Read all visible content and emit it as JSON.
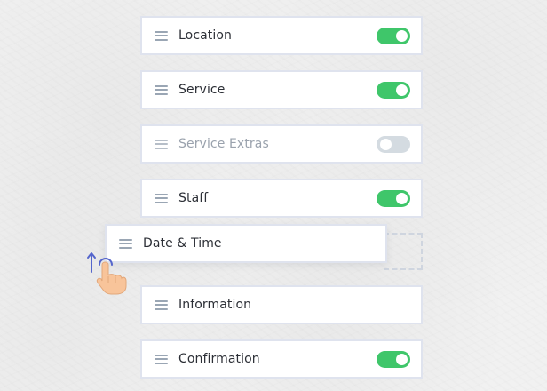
{
  "steps": [
    {
      "label": "Location",
      "toggle": "on"
    },
    {
      "label": "Service",
      "toggle": "on"
    },
    {
      "label": "Service Extras",
      "toggle": "off",
      "disabled": true
    },
    {
      "label": "Staff",
      "toggle": "on"
    },
    {
      "label": "Date & Time",
      "toggle": "none",
      "dragging": true
    },
    {
      "label": "Information",
      "toggle": "none"
    },
    {
      "label": "Confirmation",
      "toggle": "on"
    }
  ],
  "colors": {
    "toggle_on": "#3fc66a",
    "toggle_off": "#d4dbe1",
    "border": "#dfe3ee",
    "cursor_arrow": "#5566cc",
    "hand": "#f8c49a"
  },
  "icons": [
    "drag-handle-icon",
    "toggle-switch",
    "drag-hand-cursor-icon"
  ]
}
